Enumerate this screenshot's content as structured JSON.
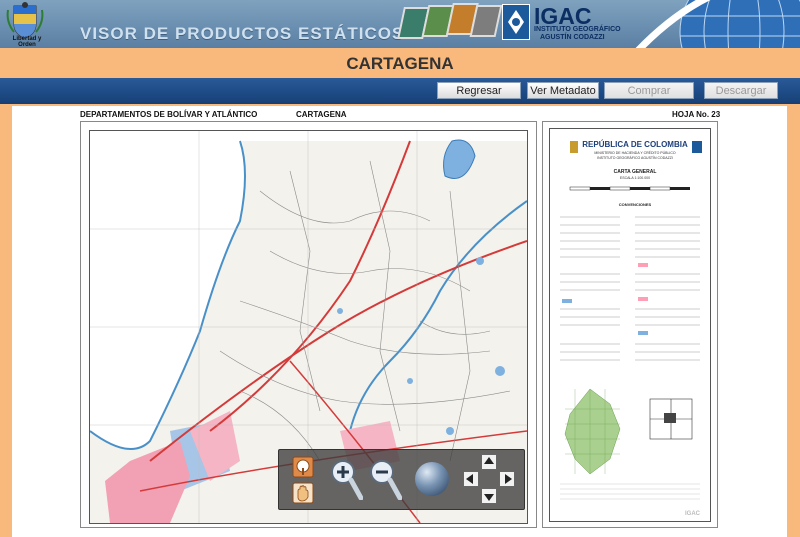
{
  "header": {
    "shield_caption": "Libertad y Orden",
    "title": "VISOR DE PRODUCTOS ESTÁTICOS",
    "brand": "IGAC",
    "brand_sub1": "INSTITUTO GEOGRÁFICO",
    "brand_sub2": "AGUSTÍN CODAZZI"
  },
  "page": {
    "city": "CARTAGENA"
  },
  "toolbar": {
    "back_label": "Regresar",
    "metadata_label": "Ver Metadato",
    "buy_label": "Comprar",
    "download_label": "Descargar"
  },
  "sheet": {
    "departments": "DEPARTAMENTOS DE BOLÍVAR Y ATLÁNTICO",
    "name": "CARTAGENA",
    "number": "HOJA No. 23"
  },
  "legend": {
    "country": "REPÚBLICA DE COLOMBIA",
    "ministry": "MINISTERIO DE HACIENDA Y CRÉDITO PÚBLICO",
    "institute": "INSTITUTO GEOGRÁFICO AGUSTÍN CODAZZI",
    "map_type": "CARTA GENERAL",
    "scale": "ESCALA 1:100.000",
    "conventions": "CONVENCIONES",
    "footer_logo": "IGAC"
  },
  "tools": {
    "icons": [
      "info-icon",
      "pan-hand-icon",
      "zoom-in-icon",
      "zoom-out-icon",
      "full-extent-globe-icon",
      "arrow-up-icon",
      "arrow-left-icon",
      "arrow-right-icon",
      "arrow-down-icon"
    ]
  },
  "colors": {
    "toolbar": "#1f4d88",
    "page_bg": "#f9b97c",
    "header": "#6b8fb0"
  }
}
